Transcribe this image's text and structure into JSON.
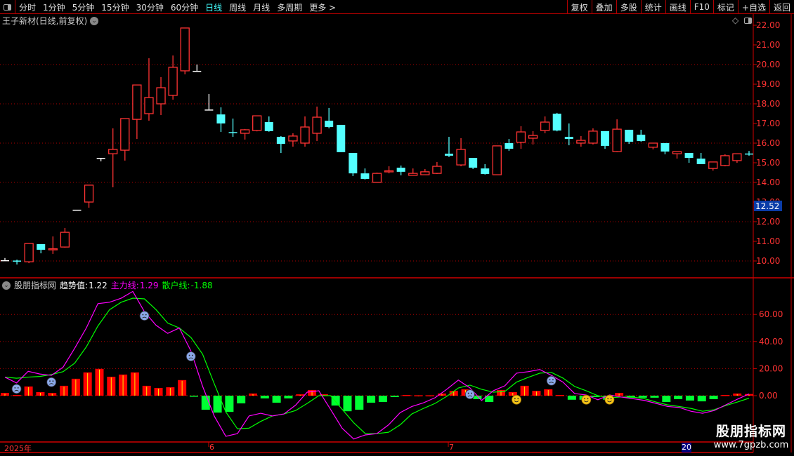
{
  "toolbar": {
    "periods": [
      "分时",
      "1分钟",
      "5分钟",
      "15分钟",
      "30分钟",
      "60分钟",
      "日线",
      "周线",
      "月线",
      "多周期",
      "更多 >"
    ],
    "active_period": "日线",
    "buttons": [
      "复权",
      "叠加",
      "多股",
      "统计",
      "画线",
      "F10",
      "标记",
      "+自选",
      "返回"
    ]
  },
  "stock": {
    "title": "王子新材(日线,前复权)"
  },
  "price_axis": {
    "labels": [
      "22.00",
      "21.00",
      "20.00",
      "19.00",
      "18.00",
      "17.00",
      "16.00",
      "15.00",
      "14.00",
      "13.00",
      "12.00",
      "11.00",
      "10.00"
    ],
    "values": [
      22,
      21,
      20,
      19,
      18,
      17,
      16,
      15,
      14,
      13,
      12,
      11,
      10
    ],
    "current_marker": "12.52"
  },
  "indicator": {
    "name": "股朋指标网",
    "trend_label": "趋势值:",
    "trend_value": "1.22",
    "main_label": "主力线:",
    "main_value": "1.29",
    "retail_label": "散户线:",
    "retail_value": "-1.88",
    "axis_labels": [
      "60.00",
      "40.00",
      "20.00",
      "0.00"
    ],
    "axis_values": [
      60,
      40,
      20,
      0
    ]
  },
  "x_axis": {
    "labels": [
      "2025年",
      "6",
      "7",
      "20"
    ]
  },
  "colors": {
    "up": "#ff3333",
    "down": "#54ffff",
    "doji": "#ffffff",
    "main_line": "#ff00ff",
    "retail_line": "#00ff00",
    "grid": "#b00000",
    "bar_up": "#ff0000",
    "bar_down": "#00ff33"
  },
  "chart_data": {
    "type": "candlestick",
    "ylim": [
      9.6,
      22.2
    ],
    "candles_ohlc": [
      [
        10.04,
        10.04,
        10.15,
        10.04
      ],
      [
        10.02,
        10.0,
        10.07,
        9.82
      ],
      [
        9.96,
        10.89,
        10.89,
        9.89
      ],
      [
        10.86,
        10.57,
        10.86,
        10.39
      ],
      [
        10.58,
        10.62,
        11.25,
        10.36
      ],
      [
        10.71,
        11.46,
        11.68,
        10.68
      ],
      [
        12.61,
        12.61,
        12.61,
        12.61
      ],
      [
        13.0,
        13.86,
        13.86,
        12.71
      ],
      [
        15.25,
        15.25,
        15.25,
        15.07
      ],
      [
        15.46,
        15.68,
        16.75,
        13.75
      ],
      [
        15.64,
        17.25,
        17.25,
        15.11
      ],
      [
        17.21,
        18.96,
        18.96,
        16.21
      ],
      [
        17.5,
        18.32,
        20.32,
        17.14
      ],
      [
        18.0,
        18.82,
        19.36,
        17.43
      ],
      [
        18.43,
        19.86,
        20.46,
        18.21
      ],
      [
        19.68,
        21.86,
        21.86,
        19.5
      ],
      [
        19.68,
        19.68,
        20.0,
        19.68
      ],
      [
        17.71,
        17.71,
        18.5,
        17.71
      ],
      [
        17.46,
        17.0,
        17.82,
        16.57
      ],
      [
        16.56,
        16.54,
        17.25,
        16.32
      ],
      [
        16.5,
        16.68,
        16.72,
        16.18
      ],
      [
        16.64,
        17.39,
        17.39,
        16.6
      ],
      [
        17.07,
        16.61,
        17.36,
        16.58
      ],
      [
        16.32,
        15.96,
        16.36,
        15.5
      ],
      [
        16.11,
        16.36,
        16.5,
        15.82
      ],
      [
        16.0,
        16.82,
        17.36,
        15.82
      ],
      [
        16.5,
        17.32,
        17.86,
        16.11
      ],
      [
        17.14,
        16.82,
        17.79,
        16.75
      ],
      [
        16.93,
        15.54,
        16.93,
        15.54
      ],
      [
        15.5,
        14.46,
        15.5,
        14.32
      ],
      [
        14.46,
        14.18,
        14.71,
        14.14
      ],
      [
        14.0,
        14.46,
        14.5,
        14.0
      ],
      [
        14.55,
        14.59,
        14.82,
        14.46
      ],
      [
        14.75,
        14.54,
        14.86,
        14.36
      ],
      [
        14.36,
        14.46,
        14.71,
        14.36
      ],
      [
        14.39,
        14.54,
        14.68,
        14.39
      ],
      [
        14.46,
        14.82,
        15.04,
        14.43
      ],
      [
        15.46,
        15.36,
        16.32,
        15.29
      ],
      [
        14.89,
        15.68,
        16.25,
        14.82
      ],
      [
        15.25,
        14.75,
        15.25,
        14.68
      ],
      [
        14.71,
        14.43,
        14.93,
        14.4
      ],
      [
        14.39,
        15.86,
        15.86,
        14.39
      ],
      [
        16.0,
        15.71,
        16.21,
        15.61
      ],
      [
        16.04,
        16.57,
        16.86,
        15.71
      ],
      [
        16.25,
        16.39,
        16.61,
        15.93
      ],
      [
        16.64,
        17.07,
        17.36,
        16.5
      ],
      [
        17.5,
        16.64,
        17.54,
        16.6
      ],
      [
        16.32,
        16.21,
        17.0,
        15.89
      ],
      [
        16.0,
        16.14,
        16.36,
        15.82
      ],
      [
        16.0,
        16.61,
        16.75,
        15.93
      ],
      [
        16.61,
        15.86,
        16.61,
        15.71
      ],
      [
        15.57,
        16.71,
        17.21,
        15.54
      ],
      [
        16.68,
        16.07,
        16.68,
        15.96
      ],
      [
        16.43,
        16.11,
        16.68,
        16.07
      ],
      [
        15.79,
        16.0,
        16.0,
        15.68
      ],
      [
        16.0,
        15.57,
        16.0,
        15.43
      ],
      [
        15.46,
        15.57,
        15.57,
        15.21
      ],
      [
        15.5,
        15.25,
        15.5,
        15.0
      ],
      [
        15.21,
        14.93,
        15.5,
        14.93
      ],
      [
        14.71,
        15.04,
        15.04,
        14.6
      ],
      [
        14.86,
        15.36,
        15.43,
        14.82
      ],
      [
        15.11,
        15.46,
        15.46,
        15.0
      ],
      [
        15.47,
        15.46,
        15.6,
        15.36
      ]
    ],
    "indicator_ylim": [
      -36,
      82
    ],
    "trend_bars": [
      2,
      0.5,
      6.8,
      2.6,
      2,
      7.3,
      12.5,
      17.2,
      19.8,
      14,
      15.6,
      17.2,
      7.3,
      5.7,
      6.2,
      11.5,
      -0.5,
      -10.4,
      -12.5,
      -12,
      -5.7,
      1.6,
      -2,
      -5.2,
      -2,
      1,
      4.2,
      1,
      -7.3,
      -11.5,
      -10.4,
      -5.2,
      -4.7,
      -1,
      0.5,
      0.3,
      0.3,
      1.6,
      3.6,
      4.7,
      -2.6,
      -4.7,
      4.2,
      2.6,
      7.3,
      3.6,
      4.7,
      0.5,
      -3,
      -3,
      -1,
      -3,
      2,
      -1.5,
      -1.5,
      -1.5,
      -4.7,
      -2.6,
      -3.6,
      -4.2,
      -2.6,
      0.5,
      1.6,
      1.22
    ],
    "main_line": [
      13.7,
      9.4,
      18,
      16,
      15,
      21,
      35,
      50,
      68,
      69,
      72,
      77,
      62,
      52,
      46,
      50,
      33,
      7,
      -15,
      -30,
      -28,
      -15,
      -13,
      -15,
      -13.5,
      -7,
      2.6,
      3.6,
      -10,
      -24,
      -32,
      -29,
      -28,
      -21.5,
      -12.5,
      -8,
      -5.3,
      -1.5,
      4.7,
      11.5,
      5.7,
      -3.5,
      3.6,
      7.3,
      16.6,
      17.7,
      19.3,
      15,
      10,
      1.6,
      0.5,
      -3,
      0.5,
      -1,
      -2.2,
      -3.5,
      -5.7,
      -8,
      -8.7,
      -11.5,
      -13,
      -11,
      -6.8,
      -2.6,
      1.29
    ],
    "retail_line": [
      13.7,
      12.9,
      13.7,
      14.2,
      15.6,
      17.7,
      24,
      36,
      51.5,
      63.5,
      69,
      72,
      71.5,
      63.5,
      53.6,
      50,
      43,
      30.7,
      8.9,
      -12,
      -24.5,
      -24,
      -19,
      -15,
      -13.5,
      -11,
      -5.7,
      0,
      0,
      -10,
      -20,
      -28,
      -28,
      -27,
      -21.5,
      -13.5,
      -9.4,
      -5.7,
      -0.5,
      5.7,
      7.8,
      4.7,
      2.6,
      3.1,
      10,
      13.5,
      16.6,
      17.2,
      13,
      6.8,
      3.6,
      0,
      -1.5,
      -1,
      -1,
      -2.2,
      -4.7,
      -6.8,
      -8,
      -9.4,
      -11.5,
      -10.4,
      -7.3,
      -4.7,
      -1.88
    ],
    "signals": [
      {
        "index": 1,
        "value": 5,
        "kind": "sad"
      },
      {
        "index": 4,
        "value": 10,
        "kind": "sad"
      },
      {
        "index": 12,
        "value": 59,
        "kind": "sad"
      },
      {
        "index": 16,
        "value": 29,
        "kind": "sad"
      },
      {
        "index": 40,
        "value": 1,
        "kind": "sad"
      },
      {
        "index": 47,
        "value": 11,
        "kind": "sad"
      },
      {
        "index": 44,
        "value": -3,
        "kind": "smile"
      },
      {
        "index": 50,
        "value": -3,
        "kind": "smile"
      },
      {
        "index": 52,
        "value": -3,
        "kind": "smile"
      }
    ]
  },
  "watermark": {
    "line1": "股朋指标网",
    "line2": "www.7gpzb.com"
  }
}
